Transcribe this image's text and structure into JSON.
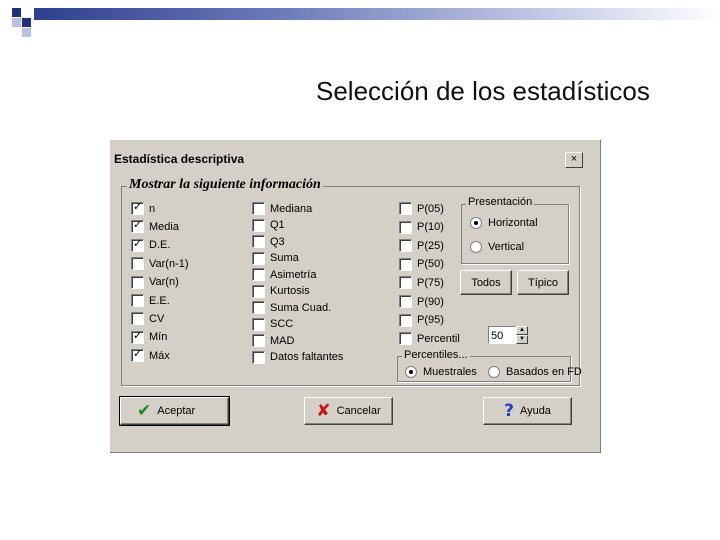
{
  "slide": {
    "title": "Selección de los estadísticos"
  },
  "dialog": {
    "title": "Estadística descriptiva",
    "close_label": "×",
    "group_main": "Mostrar la siguiente información",
    "col1": [
      {
        "label": "n",
        "checked": true
      },
      {
        "label": "Media",
        "checked": true
      },
      {
        "label": "D.E.",
        "checked": true
      },
      {
        "label": "Var(n-1)",
        "checked": false
      },
      {
        "label": "Var(n)",
        "checked": false
      },
      {
        "label": "E.E.",
        "checked": false
      },
      {
        "label": "CV",
        "checked": false
      },
      {
        "label": "Mín",
        "checked": true
      },
      {
        "label": "Máx",
        "checked": true
      }
    ],
    "col2": [
      {
        "label": "Mediana",
        "checked": false
      },
      {
        "label": "Q1",
        "checked": false
      },
      {
        "label": "Q3",
        "checked": false
      },
      {
        "label": "Suma",
        "checked": false
      },
      {
        "label": "Asimetría",
        "checked": false
      },
      {
        "label": "Kurtosis",
        "checked": false
      },
      {
        "label": "Suma Cuad.",
        "checked": false
      },
      {
        "label": "SCC",
        "checked": false
      },
      {
        "label": "MAD",
        "checked": false
      },
      {
        "label": "Datos faltantes",
        "checked": false
      }
    ],
    "col3": [
      {
        "label": "P(05)",
        "checked": false
      },
      {
        "label": "P(10)",
        "checked": false
      },
      {
        "label": "P(25)",
        "checked": false
      },
      {
        "label": "P(50)",
        "checked": false
      },
      {
        "label": "P(75)",
        "checked": false
      },
      {
        "label": "P(90)",
        "checked": false
      },
      {
        "label": "P(95)",
        "checked": false
      },
      {
        "label": "Percentil",
        "checked": false
      }
    ],
    "percentil_value": "50",
    "presentacion": {
      "label": "Presentación",
      "options": [
        "Horizontal",
        "Vertical"
      ],
      "selected": "Horizontal"
    },
    "todos_label": "Todos",
    "tipico_label": "Típico",
    "percentiles": {
      "label": "Percentiles...",
      "options": [
        "Muestrales",
        "Basados en FD"
      ],
      "selected": "Muestrales"
    },
    "buttons": {
      "accept": "Aceptar",
      "cancel": "Cancelar",
      "help": "Ayuda"
    },
    "icons": {
      "accept": "green-checkmark-icon",
      "cancel": "red-x-icon",
      "help": "blue-question-icon"
    },
    "colors": {
      "accept_icon": "#1a8c1a",
      "cancel_icon": "#cc1111",
      "help_icon": "#1f3fbf",
      "dialog_bg": "#d4d0c8"
    }
  }
}
